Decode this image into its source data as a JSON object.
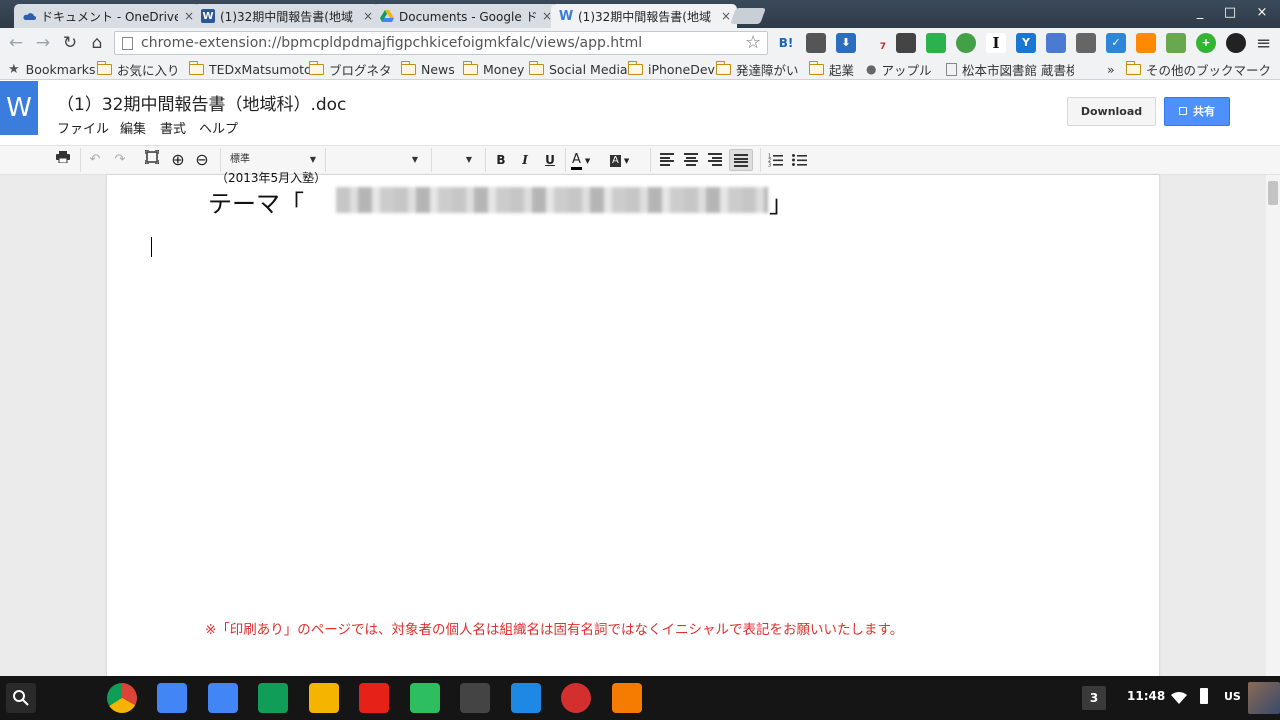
{
  "tabs": [
    {
      "title": "ドキュメント - OneDrive",
      "icon": "onedrive-icon",
      "active": false
    },
    {
      "title": "(1)32期中間報告書(地域",
      "icon": "word-icon",
      "active": false
    },
    {
      "title": "Documents - Google ド",
      "icon": "google-drive-icon",
      "active": false
    },
    {
      "title": "(1)32期中間報告書(地域",
      "icon": "word-w-icon",
      "active": true
    }
  ],
  "tab_close": "×",
  "window": {
    "minimize": "_",
    "maximize": "□",
    "close": "×"
  },
  "nav": {
    "back": "←",
    "forward": "→",
    "reload": "↻",
    "home": "⌂"
  },
  "omnibox": {
    "url": "chrome-extension://bpmcpldpdmajfigpchkicefoigmkfalc/views/app.html",
    "star": "☆"
  },
  "extensions": [
    {
      "name": "hatena-bookmark-icon",
      "label": "B!",
      "color": "#1a64b7"
    },
    {
      "name": "evernote-clip-icon",
      "label": "",
      "color": "#555555"
    },
    {
      "name": "download-icon",
      "label": "⬇",
      "color": "#2a6ebd"
    },
    {
      "name": "notification-bell-icon",
      "label": "7",
      "color": "#7a7a7a"
    },
    {
      "name": "tool-icon",
      "label": "",
      "color": "#444444"
    },
    {
      "name": "feedly-icon",
      "label": "",
      "color": "#2bb24c"
    },
    {
      "name": "leaf-icon",
      "label": "",
      "color": "#43a047"
    },
    {
      "name": "instapaper-icon",
      "label": "I",
      "color": "#222222"
    },
    {
      "name": "y-icon",
      "label": "Y",
      "color": "#1976d2"
    },
    {
      "name": "chat-icon",
      "label": "",
      "color": "#4a7bd0"
    },
    {
      "name": "eyedropper-icon",
      "label": "",
      "color": "#666666"
    },
    {
      "name": "check-icon",
      "label": "✓",
      "color": "#2f86d6"
    },
    {
      "name": "chart-up-icon",
      "label": "",
      "color": "#ff8a00"
    },
    {
      "name": "puzzle-icon",
      "label": "",
      "color": "#6aa84f"
    },
    {
      "name": "plus-circle-icon",
      "label": "+",
      "color": "#33b533"
    },
    {
      "name": "camera-icon",
      "label": "",
      "color": "#222222"
    }
  ],
  "menu_icon": "≡",
  "bookmarks": [
    {
      "label": "Bookmarks",
      "type": "star"
    },
    {
      "label": "お気に入り",
      "type": "folder"
    },
    {
      "label": "TEDxMatsumoto",
      "type": "folder"
    },
    {
      "label": "ブログネタ",
      "type": "folder"
    },
    {
      "label": "News",
      "type": "folder"
    },
    {
      "label": "Money",
      "type": "folder"
    },
    {
      "label": "Social Media",
      "type": "folder"
    },
    {
      "label": "iPhoneDev",
      "type": "folder"
    },
    {
      "label": "発達障がい",
      "type": "folder"
    },
    {
      "label": "起業",
      "type": "folder"
    },
    {
      "label": "アップル",
      "type": "apple"
    },
    {
      "label": "松本市図書館 蔵書検",
      "type": "page"
    }
  ],
  "bookmarks_overflow": "»",
  "other_bookmarks": "その他のブックマーク",
  "app": {
    "logo": "W",
    "doc_title": "（1）32期中間報告書（地域科）.doc",
    "menus": [
      "ファイル",
      "編集",
      "書式",
      "ヘルプ"
    ],
    "download_label": "Download",
    "share_label": "共有",
    "share_icon": "🔒"
  },
  "toolbar": {
    "print": "🖶",
    "undo": "↶",
    "redo": "↷",
    "zoom_in": "⊕",
    "zoom_out": "⊖",
    "style": "標準",
    "font": "",
    "size": "",
    "bold": "B",
    "italic": "I",
    "underline": "U",
    "text_color": "A",
    "highlight": "A"
  },
  "document": {
    "entry_note": "（2013年5月入塾）",
    "theme_open": "テーマ「",
    "theme_close": "」",
    "notice": "※「印刷あり」のページでは、対象者の個人名は組織名は固有名詞ではなくイニシャルで表記をお願いいたします。"
  },
  "shelf": {
    "apps": [
      {
        "name": "launcher-search-icon",
        "color": "#333333"
      },
      {
        "name": "chrome-icon",
        "color": "#dd4b39"
      },
      {
        "name": "inbox-icon",
        "color": "#4285f4"
      },
      {
        "name": "google-docs-icon",
        "color": "#4285f4"
      },
      {
        "name": "google-sheets-icon",
        "color": "#0f9d58"
      },
      {
        "name": "google-slides-icon",
        "color": "#f4b400"
      },
      {
        "name": "youtube-icon",
        "color": "#e62117"
      },
      {
        "name": "evernote-icon",
        "color": "#2dbe60"
      },
      {
        "name": "w-app-icon",
        "color": "#444444"
      },
      {
        "name": "files-icon",
        "color": "#1e88e5"
      },
      {
        "name": "red-sphere-app-icon",
        "color": "#d32f2f"
      },
      {
        "name": "headphones-icon",
        "color": "#f57c00"
      }
    ],
    "notification_count": "3",
    "time": "11:48",
    "locale": "US"
  }
}
